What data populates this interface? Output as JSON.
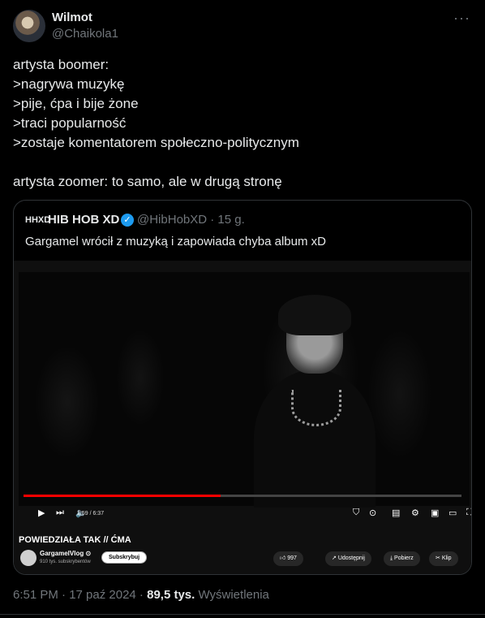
{
  "author": {
    "name": "Wilmot",
    "handle": "@Chaikola1"
  },
  "more_icon": "more-horizontal-icon",
  "tweet_lines": [
    "artysta boomer:",
    ">nagrywa muzykę",
    ">pije, ćpa i bije żone",
    ">traci popularność",
    ">zostaje komentatorem społeczno-politycznym",
    "",
    "artysta zoomer: to samo, ale w drugą stronę"
  ],
  "quote": {
    "logo_text": "HHXD",
    "name": "HIB HOB XD",
    "handle_and_time": "@HibHobXD · 15 g.",
    "text": "Gargamel wrócił z muzyką i zapowiada chyba album xD",
    "video": {
      "time": "2:59 / 6:37",
      "progress": 0.45,
      "title": "POWIEDZIAŁA TAK // ĆMA",
      "channel_name": "GargamelVlog ⊙",
      "channel_subs": "910 tys. subskrybentów",
      "subscribe_label": "Subskrybuj",
      "likes": "997",
      "share_label": "Udostępnij",
      "download_label": "Pobierz",
      "clip_label": "Klip",
      "accent_color": "#ff0000"
    }
  },
  "meta": {
    "datetime": "6:51 PM · 17 paź 2024 · ",
    "views_count": "89,5 tys.",
    "views_label": " Wyświetlenia"
  }
}
